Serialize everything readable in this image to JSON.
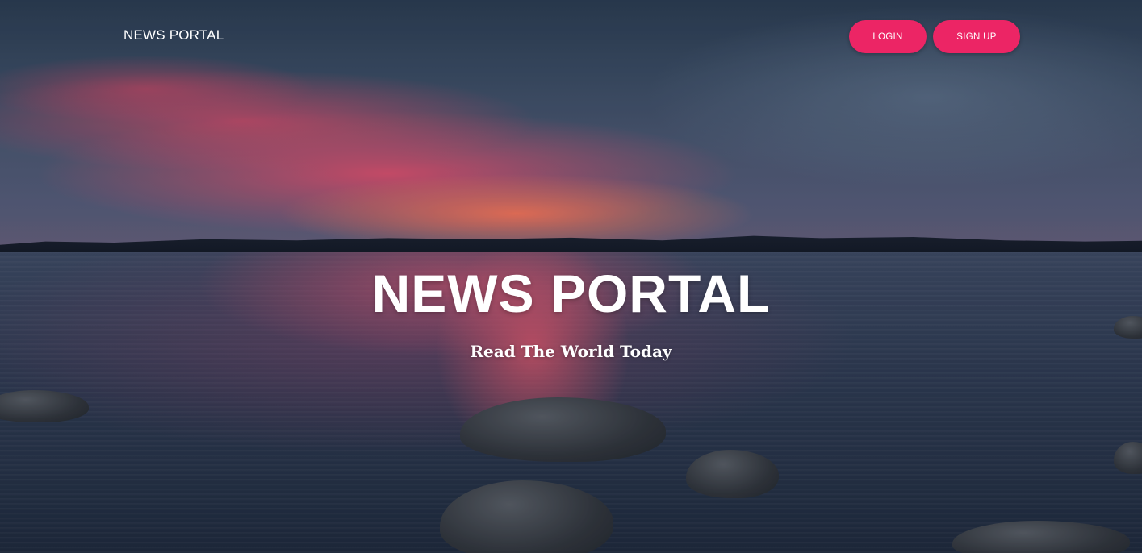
{
  "header": {
    "brand": "NEWS PORTAL",
    "login_label": "LOGIN",
    "signup_label": "SIGN UP"
  },
  "hero": {
    "title": "NEWS PORTAL",
    "tagline": "Read The World Today"
  },
  "colors": {
    "accent": "#ec2565",
    "text": "#ffffff"
  }
}
